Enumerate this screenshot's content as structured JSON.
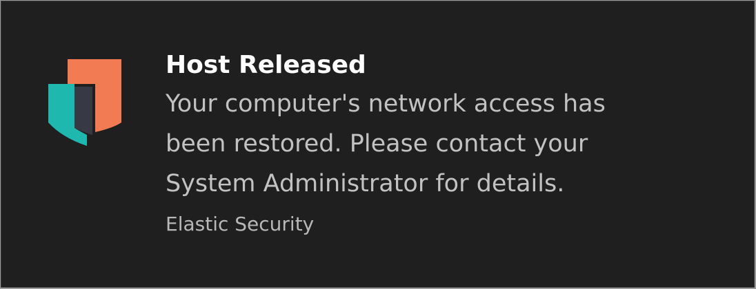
{
  "notification": {
    "title": "Host Released",
    "body_lines": [
      "Your computer's network access has",
      "been restored. Please contact your",
      "System Administrator for details."
    ],
    "source": "Elastic Security",
    "icon": "elastic-security-logo",
    "colors": {
      "background": "#1f1f1f",
      "title": "#ffffff",
      "body": "#c2c2c2",
      "logo_orange": "#f37b53",
      "logo_teal": "#1fb8ae",
      "logo_dark": "#373a44"
    }
  }
}
